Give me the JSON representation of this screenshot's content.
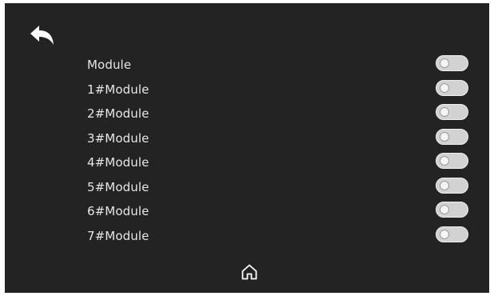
{
  "header": {
    "back_icon": "back-arrow-icon"
  },
  "modules": [
    {
      "label": "Module",
      "enabled": false
    },
    {
      "label": "1#Module",
      "enabled": false
    },
    {
      "label": "2#Module",
      "enabled": false
    },
    {
      "label": "3#Module",
      "enabled": false
    },
    {
      "label": "4#Module",
      "enabled": false
    },
    {
      "label": "5#Module",
      "enabled": false
    },
    {
      "label": "6#Module",
      "enabled": false
    },
    {
      "label": "7#Module",
      "enabled": false
    }
  ],
  "footer": {
    "home_icon": "home-icon"
  },
  "colors": {
    "background": "#232323",
    "text": "#e6e6e6",
    "toggle_off": "#d2d2d2"
  }
}
